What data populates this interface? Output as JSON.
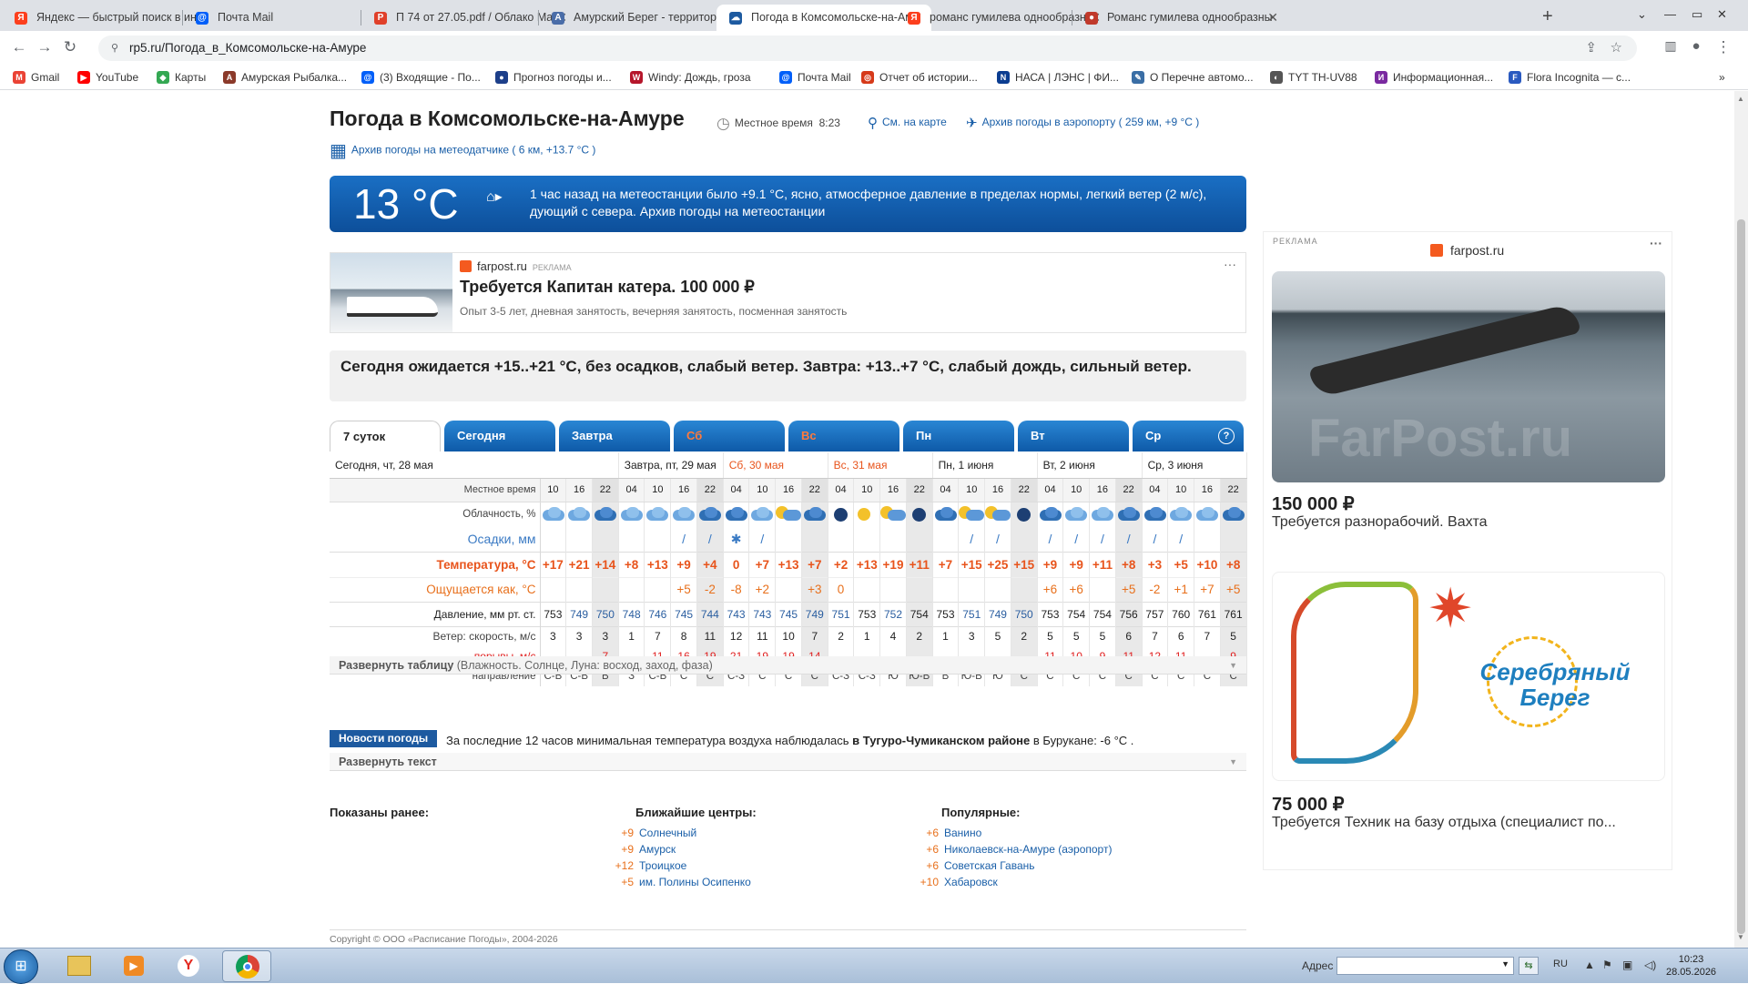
{
  "browser": {
    "tabs": [
      {
        "title": "Яндекс — быстрый поиск в инт",
        "fav": "Я",
        "color": "#fc3f1d",
        "active": false
      },
      {
        "title": "Почта Mail",
        "fav": "@",
        "color": "#005ff9",
        "active": false
      },
      {
        "title": "П 74 от 27.05.pdf / Облако Mail",
        "fav": "P",
        "color": "#e0402a",
        "active": false
      },
      {
        "title": "Амурский Берег - территория, с",
        "fav": "A",
        "color": "#4a6da8",
        "active": false
      },
      {
        "title": "Погода в Комсомольске-на-Ам",
        "fav": "☁",
        "color": "#1d5aa0",
        "active": true
      },
      {
        "title": "романс гумилева однообразны",
        "fav": "Я",
        "color": "#fc3f1d",
        "active": false
      },
      {
        "title": "Романс гумилева однообразны",
        "fav": "●",
        "color": "#c0392b",
        "active": false
      }
    ],
    "newtab": "+",
    "url": "rp5.ru/Погода_в_Комсомольске-на-Амуре",
    "bookmarks": [
      {
        "label": "Gmail",
        "fav": "M",
        "color": "#ea4335"
      },
      {
        "label": "YouTube",
        "fav": "▶",
        "color": "#ff0000"
      },
      {
        "label": "Карты",
        "fav": "◆",
        "color": "#34a853"
      },
      {
        "label": "Амурская Рыбалка...",
        "fav": "A",
        "color": "#8b3a2a"
      },
      {
        "label": "(3) Входящие - По...",
        "fav": "@",
        "color": "#005ff9"
      },
      {
        "label": "Прогноз погоды и...",
        "fav": "●",
        "color": "#1d3f8a"
      },
      {
        "label": "Windy: Дождь, гроза",
        "fav": "W",
        "color": "#b5162b"
      },
      {
        "label": "Почта Mail",
        "fav": "@",
        "color": "#005ff9"
      },
      {
        "label": "Отчет об истории...",
        "fav": "◎",
        "color": "#d63a1a"
      },
      {
        "label": "НАСА | ЛЭНС | ФИ...",
        "fav": "N",
        "color": "#0b3d91"
      },
      {
        "label": "О Перечне автомо...",
        "fav": "✎",
        "color": "#3a6ea5"
      },
      {
        "label": "TYT TH-UV88",
        "fav": "◐",
        "color": "#555555"
      },
      {
        "label": "Информационная...",
        "fav": "И",
        "color": "#7a2aa0"
      },
      {
        "label": "Flora Incognita — с...",
        "fav": "F",
        "color": "#2a5ac0"
      }
    ]
  },
  "header": {
    "title": "Погода в Комсомольске-на-Амуре",
    "local_time_label": "Местное время",
    "local_time": "8:23",
    "map_link": "См. на карте",
    "airport_link": "Архив погоды в аэропорту ( 259 км, +9 °C )",
    "station_link": "Архив погоды на метеодатчике ( 6 км, +13.7 °C )"
  },
  "current": {
    "temp": "13 °C",
    "text": "1 час назад на метеостанции было +9.1 °C, ясно, атмосферное давление в пределах нормы, легкий ветер (2 м/с), дующий с севера. Архив погоды на метеостанции"
  },
  "ad_top": {
    "source": "farpost.ru",
    "tag": "РЕКЛАМА",
    "title": "Требуется Капитан катера. 100 000 ₽",
    "desc": "Опыт 3-5 лет, дневная занятость, вечерняя занятость, посменная занятость",
    "menu": "···"
  },
  "forecast_text": "Сегодня ожидается +15..+21 °C, без осадков, слабый ветер. Завтра: +13..+7 °C, слабый дождь, сильный ветер.",
  "day_tabs": [
    {
      "label": "7 суток",
      "weekend": false
    },
    {
      "label": "Сегодня",
      "weekend": false
    },
    {
      "label": "Завтра",
      "weekend": false
    },
    {
      "label": "Сб",
      "weekend": true
    },
    {
      "label": "Вс",
      "weekend": true
    },
    {
      "label": "Пн",
      "weekend": false
    },
    {
      "label": "Вт",
      "weekend": false
    },
    {
      "label": "Ср",
      "weekend": false
    }
  ],
  "help_icon": "?",
  "table": {
    "labels": {
      "hours": "Местное время",
      "clouds": "Облачность, %",
      "precip": "Осадки, мм",
      "temp": "Температура, °C",
      "feel": "Ощущается как, °C",
      "pres": "Давление, мм рт. ст.",
      "wind": "Ветер: скорость, м/с",
      "gust": "порывы, м/с",
      "dir": "направление"
    },
    "days": [
      {
        "label": "Сегодня, чт, 28 мая",
        "span": 3,
        "weekend": false
      },
      {
        "label": "Завтра, пт, 29 мая",
        "span": 4,
        "weekend": false
      },
      {
        "label": "Сб, 30 мая",
        "span": 4,
        "weekend": true
      },
      {
        "label": "Вс, 31 мая",
        "span": 4,
        "weekend": true
      },
      {
        "label": "Пн, 1 июня",
        "span": 4,
        "weekend": false
      },
      {
        "label": "Вт, 2 июня",
        "span": 4,
        "weekend": false
      },
      {
        "label": "Ср, 3 июня",
        "span": 4,
        "weekend": false
      }
    ],
    "hours": [
      "10",
      "16",
      "22",
      "04",
      "10",
      "16",
      "22",
      "04",
      "10",
      "16",
      "22",
      "04",
      "10",
      "16",
      "22",
      "04",
      "10",
      "16",
      "22",
      "04",
      "10",
      "16",
      "22",
      "04",
      "10",
      "16",
      "22"
    ],
    "clouds": [
      "light",
      "light",
      "dark",
      "light",
      "light",
      "light",
      "dark",
      "dark",
      "light",
      "part",
      "dark",
      "night",
      "sunny",
      "part",
      "night",
      "dark",
      "part",
      "part",
      "night",
      "dark",
      "light",
      "light",
      "dark",
      "dark",
      "light",
      "light",
      "dark"
    ],
    "precip": [
      "",
      "",
      "",
      "",
      "",
      "/",
      "/",
      "✱",
      "/",
      "",
      "",
      "",
      "",
      "",
      "",
      "",
      "/",
      "/",
      "",
      "/",
      "/",
      "/",
      "/",
      "/",
      "/",
      "",
      ""
    ],
    "temp": [
      "+17",
      "+21",
      "+14",
      "+8",
      "+13",
      "+9",
      "+4",
      "0",
      "+7",
      "+13",
      "+7",
      "+2",
      "+13",
      "+19",
      "+11",
      "+7",
      "+15",
      "+25",
      "+15",
      "+9",
      "+9",
      "+11",
      "+8",
      "+3",
      "+5",
      "+10",
      "+8"
    ],
    "feel": [
      "",
      "",
      "",
      "",
      "",
      "+5",
      "-2",
      "-8",
      "+2",
      "",
      "+3",
      "0",
      "",
      "",
      "",
      "",
      "",
      "",
      "",
      "+6",
      "+6",
      "",
      "+5",
      "-2",
      "+1",
      "+7",
      "+5"
    ],
    "pres": [
      "753",
      "749",
      "750",
      "748",
      "746",
      "745",
      "744",
      "743",
      "743",
      "745",
      "749",
      "751",
      "753",
      "752",
      "754",
      "753",
      "751",
      "749",
      "750",
      "753",
      "754",
      "754",
      "756",
      "757",
      "760",
      "761",
      "761"
    ],
    "wind": [
      "3",
      "3",
      "3",
      "1",
      "7",
      "8",
      "11",
      "12",
      "11",
      "10",
      "7",
      "2",
      "1",
      "4",
      "2",
      "1",
      "3",
      "5",
      "2",
      "5",
      "5",
      "5",
      "6",
      "7",
      "6",
      "7",
      "5"
    ],
    "gust": [
      "",
      "",
      "7",
      "",
      "11",
      "16",
      "19",
      "21",
      "19",
      "19",
      "14",
      "",
      "",
      "",
      "",
      "",
      "",
      "",
      "",
      "11",
      "10",
      "9",
      "11",
      "12",
      "11",
      "",
      "9"
    ],
    "dir": [
      "С-В",
      "С-В",
      "В",
      "З",
      "С-В",
      "С",
      "С",
      "С-З",
      "С",
      "С",
      "С",
      "С-З",
      "С-З",
      "Ю",
      "Ю-В",
      "В",
      "Ю-В",
      "Ю",
      "С",
      "С",
      "С",
      "С",
      "С",
      "С",
      "С",
      "С",
      "С"
    ]
  },
  "expand_table": {
    "label": "Развернуть таблицу",
    "hint": "(Влажность. Солнце, Луна: восход, заход, фаза)"
  },
  "news": {
    "label": "Новости погоды",
    "text_before": "За последние 12 часов минимальная температура воздуха наблюдалась",
    "text_bold": "в Тугуро-Чумиканском районе",
    "text_after": "в Бурукане: -6 °C ."
  },
  "expand_text": "Развернуть текст",
  "shown_before": "Показаны ранее:",
  "nearest": {
    "title": "Ближайшие центры:",
    "items": [
      {
        "v": "+9",
        "name": "Солнечный"
      },
      {
        "v": "+9",
        "name": "Амурск"
      },
      {
        "v": "+12",
        "name": "Троицкое"
      },
      {
        "v": "+5",
        "name": "им. Полины Осипенко"
      }
    ]
  },
  "popular": {
    "title": "Популярные:",
    "items": [
      {
        "v": "+6",
        "name": "Ванино"
      },
      {
        "v": "+6",
        "name": "Николаевск-на-Амуре (аэропорт)"
      },
      {
        "v": "+6",
        "name": "Советская Гавань"
      },
      {
        "v": "+10",
        "name": "Хабаровск"
      }
    ]
  },
  "copyright": "Copyright © ООО «Расписание Погоды», 2004-2026",
  "side_ad": {
    "tag": "РЕКЛАМА",
    "source": "farpost.ru",
    "watermark": "FarPost.ru",
    "price1": "150 000 ₽",
    "desc1": "Требуется разнорабочий. Вахта",
    "logo": "Серебряный Берег",
    "price2": "75 000 ₽",
    "desc2": "Требуется Техник на базу отдыха (специалист по...",
    "menu": "···"
  },
  "taskbar": {
    "address_label": "Адрес",
    "lang": "RU",
    "time": "10:23",
    "date": "28.05.2026"
  }
}
